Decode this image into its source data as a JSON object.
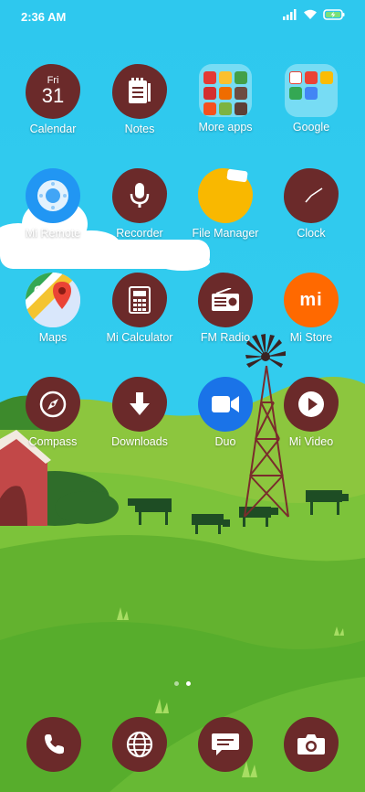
{
  "status_bar": {
    "time": "2:36 AM",
    "icons": [
      "signal-icon",
      "wifi-icon",
      "battery-charging-icon"
    ]
  },
  "theme": {
    "icon_color": "#6b2a2a",
    "sky_color": "#2ec8ee",
    "grass_color": "#57ad2c"
  },
  "apps": [
    {
      "label": "Calendar",
      "icon": "calendar-icon",
      "day": "Fri",
      "date": "31"
    },
    {
      "label": "Notes",
      "icon": "notes-icon"
    },
    {
      "label": "More apps",
      "icon": "folder-icon"
    },
    {
      "label": "Google",
      "icon": "folder-icon"
    },
    {
      "label": "Mi Remote",
      "icon": "remote-icon"
    },
    {
      "label": "Recorder",
      "icon": "microphone-icon"
    },
    {
      "label": "File Manager",
      "icon": "folder-file-icon"
    },
    {
      "label": "Clock",
      "icon": "clock-icon"
    },
    {
      "label": "Maps",
      "icon": "maps-icon"
    },
    {
      "label": "Mi Calculator",
      "icon": "calculator-icon"
    },
    {
      "label": "FM Radio",
      "icon": "radio-icon"
    },
    {
      "label": "Mi Store",
      "icon": "mi-store-icon",
      "badge": "mi"
    },
    {
      "label": "Compass",
      "icon": "compass-icon"
    },
    {
      "label": "Downloads",
      "icon": "download-icon"
    },
    {
      "label": "Duo",
      "icon": "video-camera-icon"
    },
    {
      "label": "Mi Video",
      "icon": "play-icon"
    }
  ],
  "page_indicator": {
    "pages": 2,
    "current": 2
  },
  "dock": [
    {
      "name": "Phone",
      "icon": "phone-icon"
    },
    {
      "name": "Browser",
      "icon": "globe-icon"
    },
    {
      "name": "Messages",
      "icon": "message-icon"
    },
    {
      "name": "Camera",
      "icon": "camera-icon"
    }
  ]
}
